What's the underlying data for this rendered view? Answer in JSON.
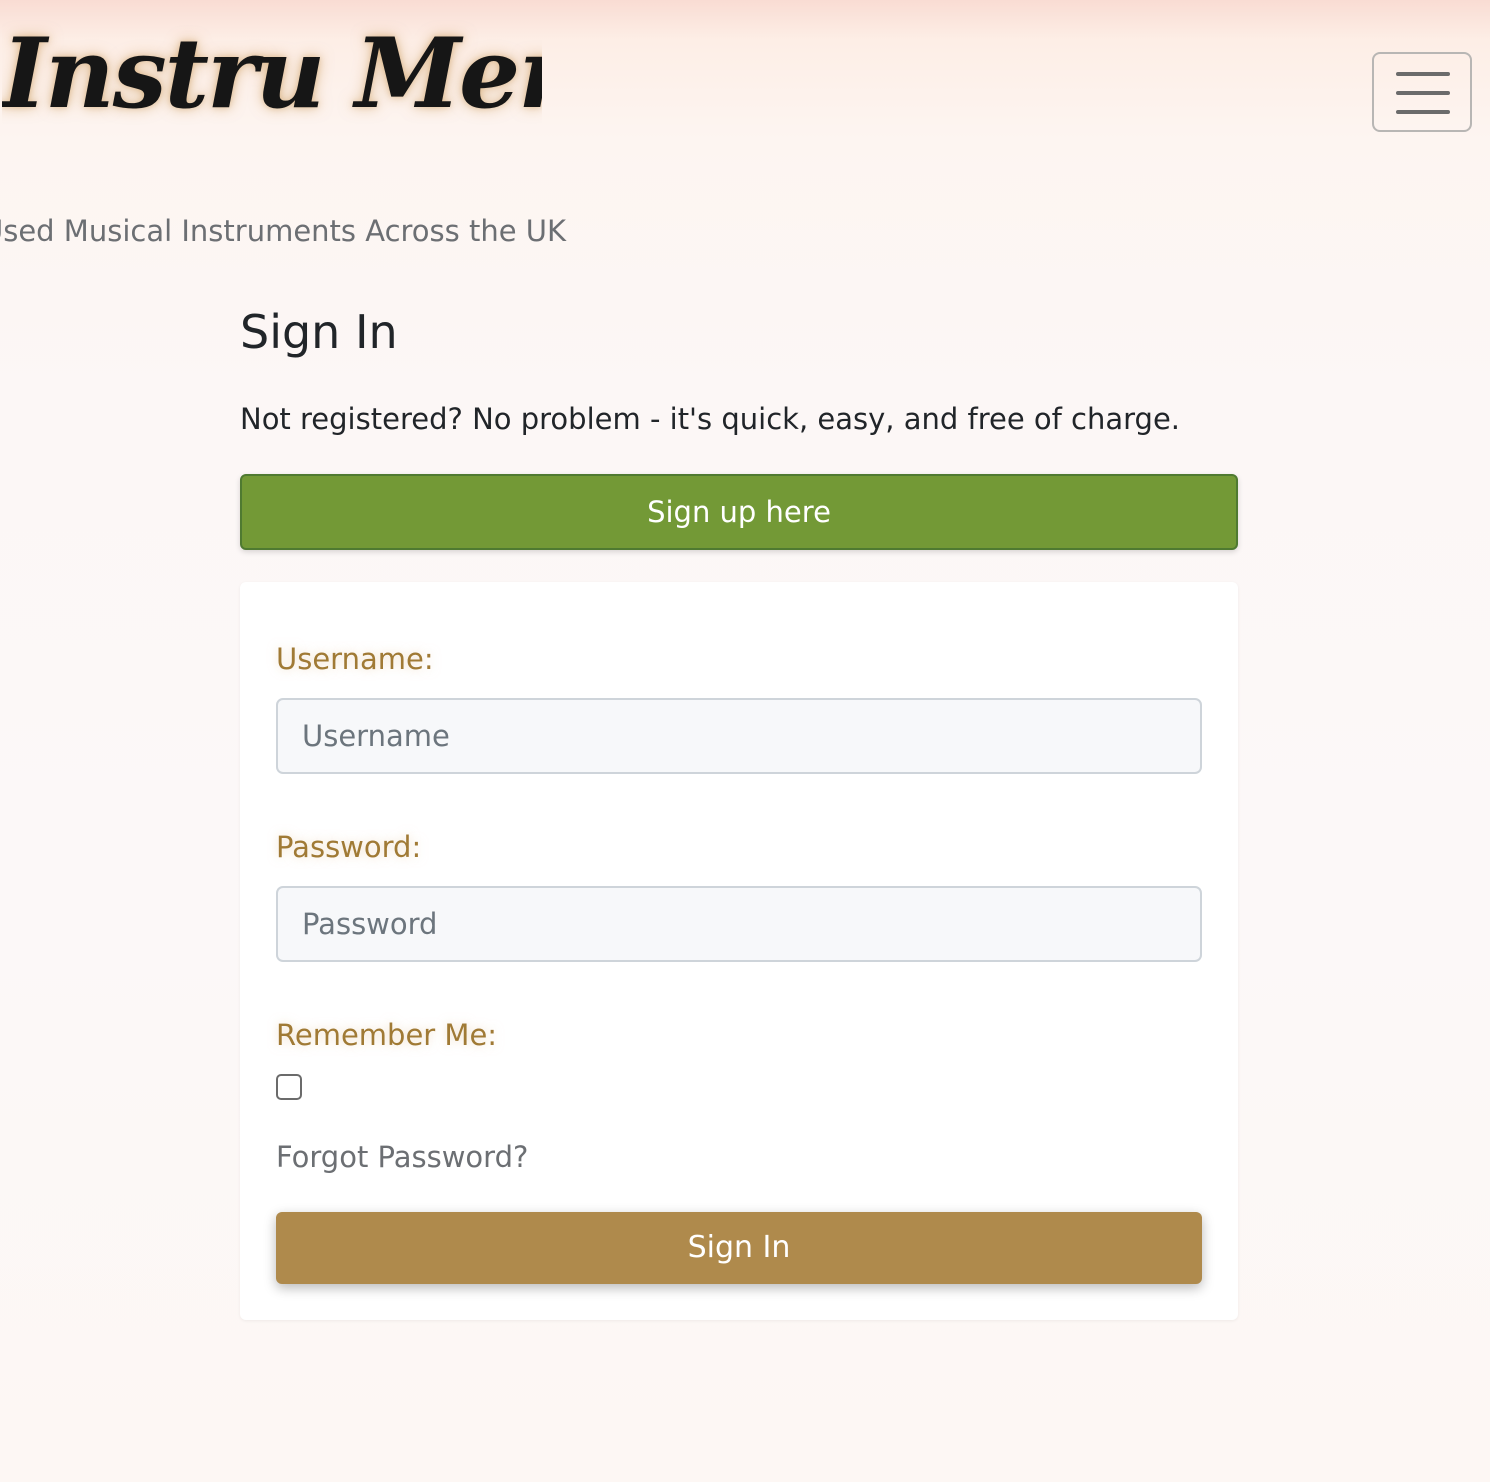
{
  "header": {
    "brand": "Instru Mental",
    "tagline": "Used Musical Instruments Across the UK",
    "menu_icon": "hamburger-menu-icon"
  },
  "main": {
    "title": "Sign In",
    "intro": "Not registered? No problem - it's quick, easy, and free of charge.",
    "signup_button": "Sign up here"
  },
  "form": {
    "username_label": "Username:",
    "username_placeholder": "Username",
    "username_value": "",
    "password_label": "Password:",
    "password_placeholder": "Password",
    "password_value": "",
    "remember_label": "Remember Me:",
    "remember_checked": false,
    "forgot_link": "Forgot Password?",
    "submit_button": "Sign In"
  },
  "colors": {
    "signup_button_bg": "#739936",
    "submit_button_bg": "#af8a4c",
    "label_color": "#a07a35"
  }
}
